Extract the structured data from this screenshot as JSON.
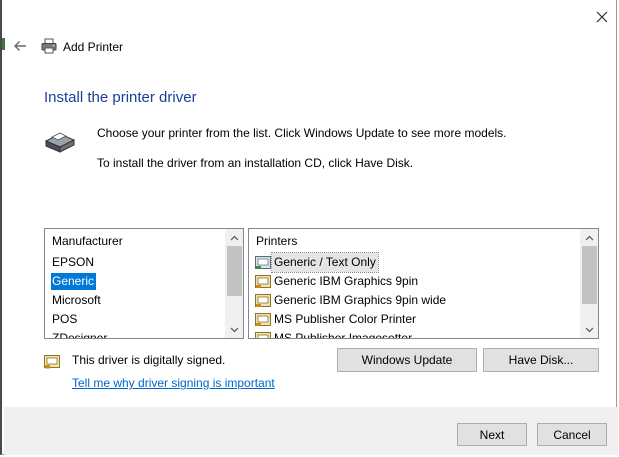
{
  "window": {
    "title": "Add Printer",
    "close_icon": "close-icon",
    "back_icon": "back-arrow-icon",
    "title_icon": "printer-icon"
  },
  "main": {
    "heading": "Install the printer driver",
    "instruction_1": "Choose your printer from the list. Click Windows Update to see more models.",
    "instruction_2": "To install the driver from an installation CD, click Have Disk."
  },
  "manufacturer_list": {
    "header": "Manufacturer",
    "items": [
      "EPSON",
      "Generic",
      "Microsoft",
      "POS",
      "ZDesigner"
    ],
    "selected": "Generic"
  },
  "printers_list": {
    "header": "Printers",
    "items": [
      "Generic / Text Only",
      "Generic IBM Graphics 9pin",
      "Generic IBM Graphics 9pin wide",
      "MS Publisher Color Printer",
      "MS Publisher Imagesetter"
    ],
    "selected": "Generic / Text Only"
  },
  "signing": {
    "status_text": "This driver is digitally signed.",
    "link_text": "Tell me why driver signing is important"
  },
  "buttons": {
    "windows_update": "Windows Update",
    "have_disk": "Have Disk...",
    "next": "Next",
    "cancel": "Cancel"
  },
  "colors": {
    "heading": "#1a3e9a",
    "selection": "#0078d7",
    "link": "#0066cc",
    "footer_bg": "#f0f0f0"
  }
}
